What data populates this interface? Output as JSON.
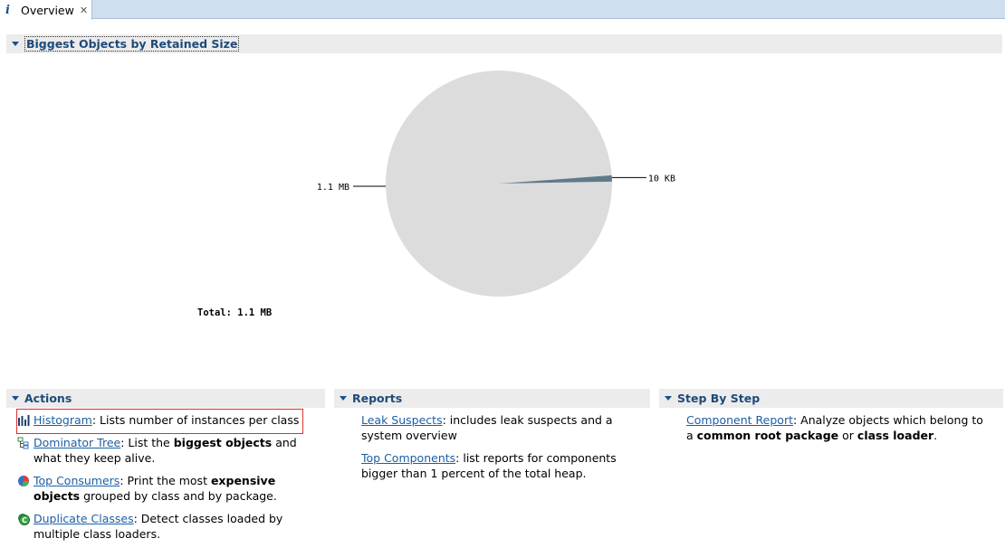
{
  "tab": {
    "icon": "info-icon",
    "label": "Overview",
    "close": "close-icon"
  },
  "biggest_objects": {
    "title": "Biggest Objects by Retained Size"
  },
  "chart_data": {
    "type": "pie",
    "slices": [
      {
        "label": "1.1 MB",
        "value": 1126.4,
        "color": "#dcdcdc"
      },
      {
        "label": "10 KB",
        "value": 10,
        "color": "#5f7a8a"
      }
    ],
    "total_label": "Total: 1.1 MB"
  },
  "actions": {
    "title": "Actions",
    "items": [
      {
        "icon": "histogram-icon",
        "link": "Histogram",
        "text_parts": [
          ": Lists number of instances per class"
        ]
      },
      {
        "icon": "dominator-tree-icon",
        "link": "Dominator Tree",
        "pre": ": List the ",
        "bold": "biggest objects",
        "post": " and what they keep alive."
      },
      {
        "icon": "top-consumers-icon",
        "link": "Top Consumers",
        "pre": ": Print the most ",
        "bold": "expensive objects",
        "post": " grouped by class and by package."
      },
      {
        "icon": "duplicate-classes-icon",
        "link": "Duplicate Classes",
        "pre": ": Detect classes loaded by multiple class loaders.",
        "bold": "",
        "post": ""
      }
    ]
  },
  "reports": {
    "title": "Reports",
    "items": [
      {
        "link": "Leak Suspects",
        "text": ": includes leak suspects and a system overview"
      },
      {
        "link": "Top Components",
        "text": ": list reports for components bigger than 1 percent of the total heap."
      }
    ]
  },
  "step_by_step": {
    "title": "Step By Step",
    "items": [
      {
        "link": "Component Report",
        "pre": ": Analyze objects which belong to a ",
        "bold1": "common root package",
        "mid": " or ",
        "bold2": "class loader",
        "post": "."
      }
    ]
  }
}
